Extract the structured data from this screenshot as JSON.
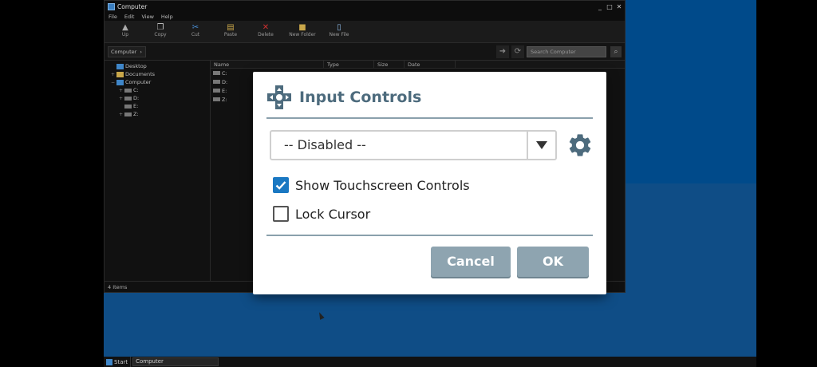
{
  "explorer": {
    "title": "Computer",
    "window_buttons": [
      "_",
      "□",
      "✕"
    ],
    "menu": [
      "File",
      "Edit",
      "View",
      "Help"
    ],
    "toolbar": [
      {
        "label": "Up",
        "icon": "up-arrow-icon"
      },
      {
        "label": "Copy",
        "icon": "copy-icon"
      },
      {
        "label": "Cut",
        "icon": "cut-icon"
      },
      {
        "label": "Paste",
        "icon": "paste-icon"
      },
      {
        "label": "Delete",
        "icon": "delete-icon"
      },
      {
        "label": "New Folder",
        "icon": "new-folder-icon"
      },
      {
        "label": "New File",
        "icon": "new-file-icon"
      }
    ],
    "address": "Computer",
    "search_placeholder": "Search Computer",
    "tree": [
      {
        "label": "Desktop",
        "expander": ""
      },
      {
        "label": "Documents",
        "expander": "+"
      },
      {
        "label": "Computer",
        "expander": "−"
      },
      {
        "label": "C:",
        "expander": "+"
      },
      {
        "label": "D:",
        "expander": "+"
      },
      {
        "label": "E:",
        "expander": ""
      },
      {
        "label": "Z:",
        "expander": "+"
      }
    ],
    "columns": [
      "Name",
      "Type",
      "Size",
      "Date"
    ],
    "files": [
      "C:",
      "D:",
      "E:",
      "Z:"
    ],
    "status": "4 Items"
  },
  "taskbar": {
    "start_label": "Start",
    "item_label": "Computer"
  },
  "dialog": {
    "title": "Input Controls",
    "select_value": "-- Disabled --",
    "show_touch_label": "Show Touchscreen Controls",
    "show_touch_checked": true,
    "lock_cursor_label": "Lock Cursor",
    "lock_cursor_checked": false,
    "cancel_label": "Cancel",
    "ok_label": "OK",
    "accent_color": "#4d6b7d",
    "button_color": "#8ea4b0",
    "checkbox_color": "#1a78c2"
  }
}
